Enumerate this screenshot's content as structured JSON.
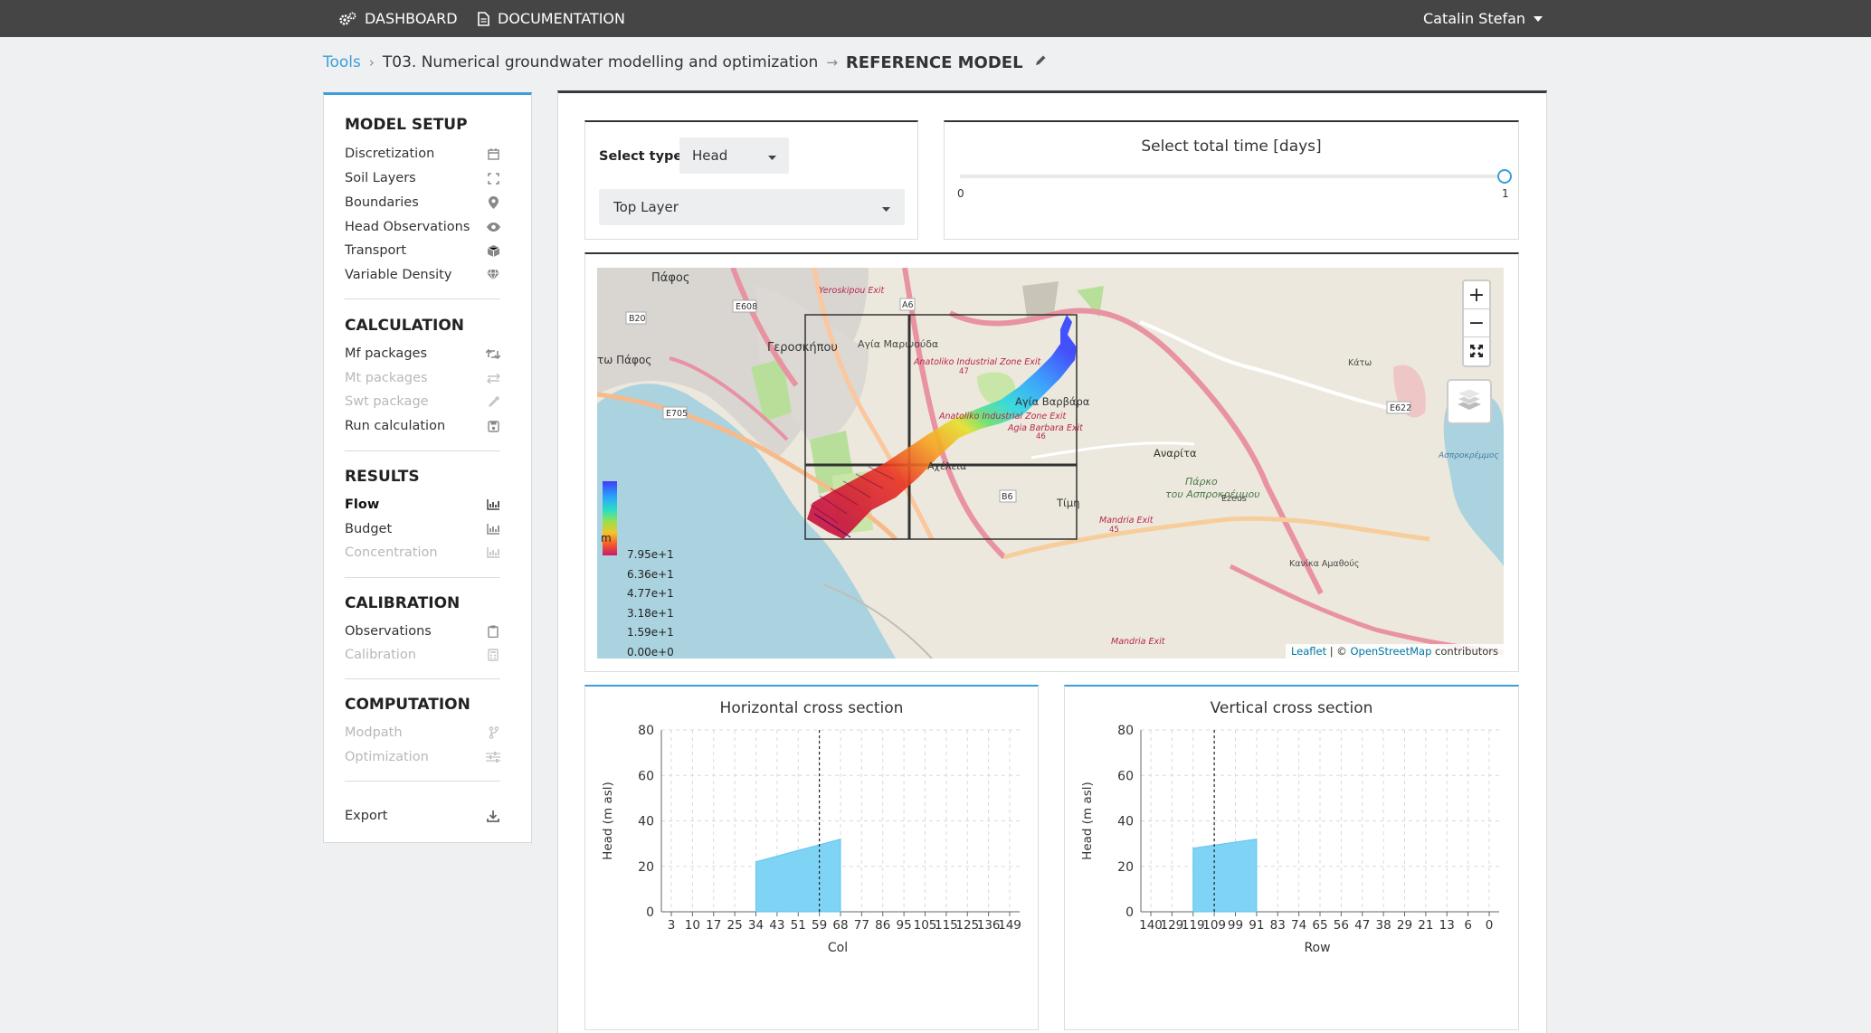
{
  "topbar": {
    "dashboard": "DASHBOARD",
    "documentation": "DOCUMENTATION",
    "user": "Catalin Stefan"
  },
  "breadcrumb": {
    "root": "Tools",
    "tool": "T03. Numerical groundwater modelling and optimization",
    "current": "REFERENCE MODEL"
  },
  "sidebar": {
    "model_setup": {
      "title": "MODEL SETUP",
      "items": [
        "Discretization",
        "Soil Layers",
        "Boundaries",
        "Head Observations",
        "Transport",
        "Variable Density"
      ]
    },
    "calculation": {
      "title": "CALCULATION",
      "items": [
        "Mf packages",
        "Mt packages",
        "Swt package",
        "Run calculation"
      ]
    },
    "results": {
      "title": "RESULTS",
      "items": [
        "Flow",
        "Budget",
        "Concentration"
      ]
    },
    "calibration": {
      "title": "CALIBRATION",
      "items": [
        "Observations",
        "Calibration"
      ]
    },
    "computation": {
      "title": "COMPUTATION",
      "items": [
        "Modpath",
        "Optimization"
      ]
    },
    "export": "Export"
  },
  "controls": {
    "select_type_label": "Select type",
    "select_type_value": "Head",
    "layer_value": "Top Layer",
    "time_title": "Select total time [days]",
    "time_min": "0",
    "time_max": "1",
    "time_value": 1
  },
  "map": {
    "zoom_in": "+",
    "zoom_out": "−",
    "attribution_leaflet": "Leaflet",
    "attribution_sep": " | © ",
    "attribution_osm": "OpenStreetMap",
    "attribution_rest": " contributors",
    "legend_unit": "m",
    "legend_values": [
      "7.95e+1",
      "6.36e+1",
      "4.77e+1",
      "3.18e+1",
      "1.59e+1",
      "0.00e+0"
    ],
    "places": [
      "Πάφος",
      "Γεροσκήπου",
      "Αγία Μαρινούδα",
      "Αγία Βαρβάρα",
      "Αναρίτα",
      "Τίμη",
      "Πάρκο",
      "του Ασπροκρέμμου",
      "τω Πάφος",
      "Αχέλεια",
      "Yeroskipou Exit",
      "Anatoliko Industrial Zone Exit",
      "Anatoliko Industrial Zone Exit",
      "Agia Barbara Exit",
      "Mandria Exit",
      "Mandria Exit",
      "Ασπροκρέμμος",
      "Ezeus",
      "Κάτω",
      "Κανίκα Αμαθούς"
    ],
    "roads": [
      "E608",
      "B20",
      "E705",
      "A6",
      "E622",
      "B6",
      "47",
      "46",
      "45"
    ]
  },
  "chart_data": [
    {
      "type": "area",
      "title": "Horizontal cross section",
      "xlabel": "Col",
      "ylabel": "Head (m asl)",
      "ylim": [
        0,
        80
      ],
      "yticks": [
        0,
        20,
        40,
        60,
        80
      ],
      "xticks": [
        "3",
        "10",
        "17",
        "25",
        "34",
        "43",
        "51",
        "59",
        "68",
        "77",
        "86",
        "95",
        "105",
        "115",
        "125",
        "136",
        "149"
      ],
      "x": [
        "34",
        "68"
      ],
      "values": [
        22,
        32
      ],
      "marker": "59",
      "grid": true
    },
    {
      "type": "area",
      "title": "Vertical cross section",
      "xlabel": "Row",
      "ylabel": "Head (m asl)",
      "ylim": [
        0,
        80
      ],
      "yticks": [
        0,
        20,
        40,
        60,
        80
      ],
      "xticks": [
        "140",
        "129",
        "119",
        "109",
        "99",
        "91",
        "83",
        "74",
        "65",
        "56",
        "47",
        "38",
        "29",
        "21",
        "13",
        "6",
        "0"
      ],
      "x": [
        "119",
        "91"
      ],
      "values": [
        28,
        32
      ],
      "marker": "109",
      "grid": true
    }
  ],
  "colors": {
    "accent": "#3a9fd8",
    "topbar": "#454545",
    "area_fill": "#7fd4f5",
    "heads_high": "#3050ff",
    "heads_low": "#c8103c"
  }
}
